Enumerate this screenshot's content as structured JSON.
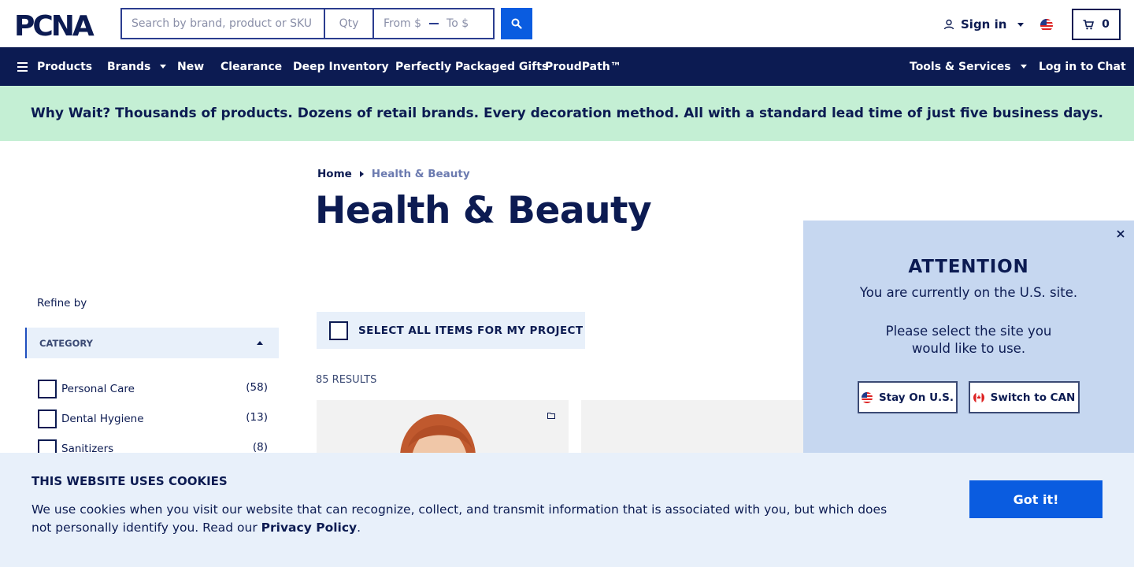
{
  "header": {
    "logo_text": "PCNA",
    "search_placeholder": "Search by brand, product or SKU",
    "qty_placeholder": "Qty",
    "price_from": "From $",
    "price_to": "To $",
    "sign_in": "Sign in",
    "cart_count": "0"
  },
  "nav": {
    "products": "Products",
    "brands": "Brands",
    "new": "New",
    "clearance": "Clearance",
    "deep_inventory": "Deep Inventory",
    "gifts": "Perfectly Packaged Gifts",
    "proudpath": "ProudPath™",
    "tools": "Tools & Services",
    "chat": "Log in to Chat"
  },
  "banner": {
    "text": "Why Wait? Thousands of products. Dozens of retail brands. Every decoration method. All with a standard lead time of just five business days."
  },
  "breadcrumb": {
    "home": "Home",
    "current": "Health & Beauty"
  },
  "page": {
    "title": "Health & Beauty",
    "select_all": "SELECT ALL ITEMS FOR MY PROJECT",
    "results": "85 RESULTS"
  },
  "sidebar": {
    "refine_by": "Refine by",
    "category_header": "CATEGORY",
    "categories": [
      {
        "label": "Personal Care",
        "count": "(58)"
      },
      {
        "label": "Dental Hygiene",
        "count": "(13)"
      },
      {
        "label": "Sanitizers",
        "count": "(8)"
      }
    ]
  },
  "attention": {
    "title": "ATTENTION",
    "line1": "You are currently on the U.S. site.",
    "line2": "Please select the site you",
    "line3": "would like to use.",
    "stay_button": "Stay On U.S.",
    "switch_button": "Switch to CAN"
  },
  "cookie": {
    "title": "THIS WEBSITE USES COOKIES",
    "text_before": "We use cookies when you visit our website that can recognize, collect, and transmit information that is associated with you, but which does not personally identify you. Read our ",
    "link": "Privacy Policy",
    "text_after": ".",
    "button": "Got it!"
  },
  "colors": {
    "navy": "#0c1b52",
    "accent_blue": "#0a5ce0",
    "banner_green": "#c4efd4",
    "light_blue": "#e8f0fa",
    "modal_blue": "#c6d7f0"
  }
}
